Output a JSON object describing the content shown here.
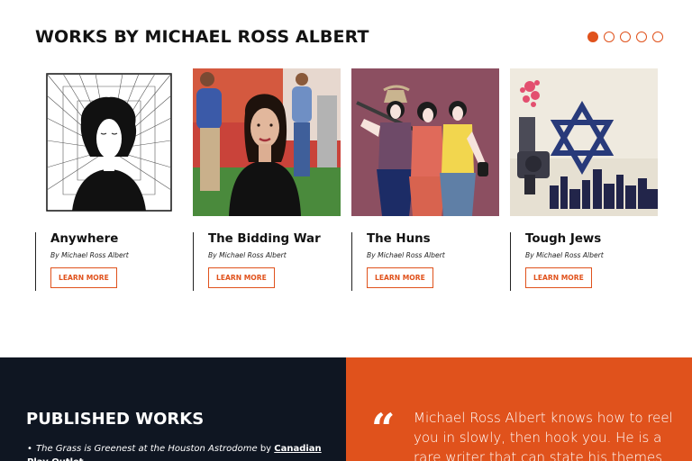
{
  "works": {
    "title": "WORKS BY MICHAEL ROSS ALBERT",
    "carousel_pages": 5,
    "carousel_active_page": 1,
    "accent_color": "#e0521c",
    "cards": [
      {
        "title": "Anywhere",
        "author": "By Michael Ross Albert",
        "button": "LEARN MORE",
        "image": "line-art-woman-portrait"
      },
      {
        "title": "The Bidding War",
        "author": "By Michael Ross Albert",
        "button": "LEARN MORE",
        "image": "photo-cast-woman-in-black"
      },
      {
        "title": "The Huns",
        "author": "By Michael Ross Albert",
        "button": "LEARN MORE",
        "image": "illustration-three-figures"
      },
      {
        "title": "Tough Jews",
        "author": "By Michael Ross Albert",
        "button": "LEARN MORE",
        "image": "star-of-david-revolver-cityscape"
      }
    ]
  },
  "published": {
    "title": "PUBLISHED WORKS",
    "items": [
      {
        "title": "The Grass is Greenest at the Houston Astrodome",
        "by": "by",
        "publisher": "Canadian Play Outlet"
      }
    ],
    "background": "#0f1622"
  },
  "quote": {
    "mark": "“",
    "text": "Michael Ross Albert knows how to reel you in slowly, then hook you. He is a rare writer that can state his themes"
  }
}
